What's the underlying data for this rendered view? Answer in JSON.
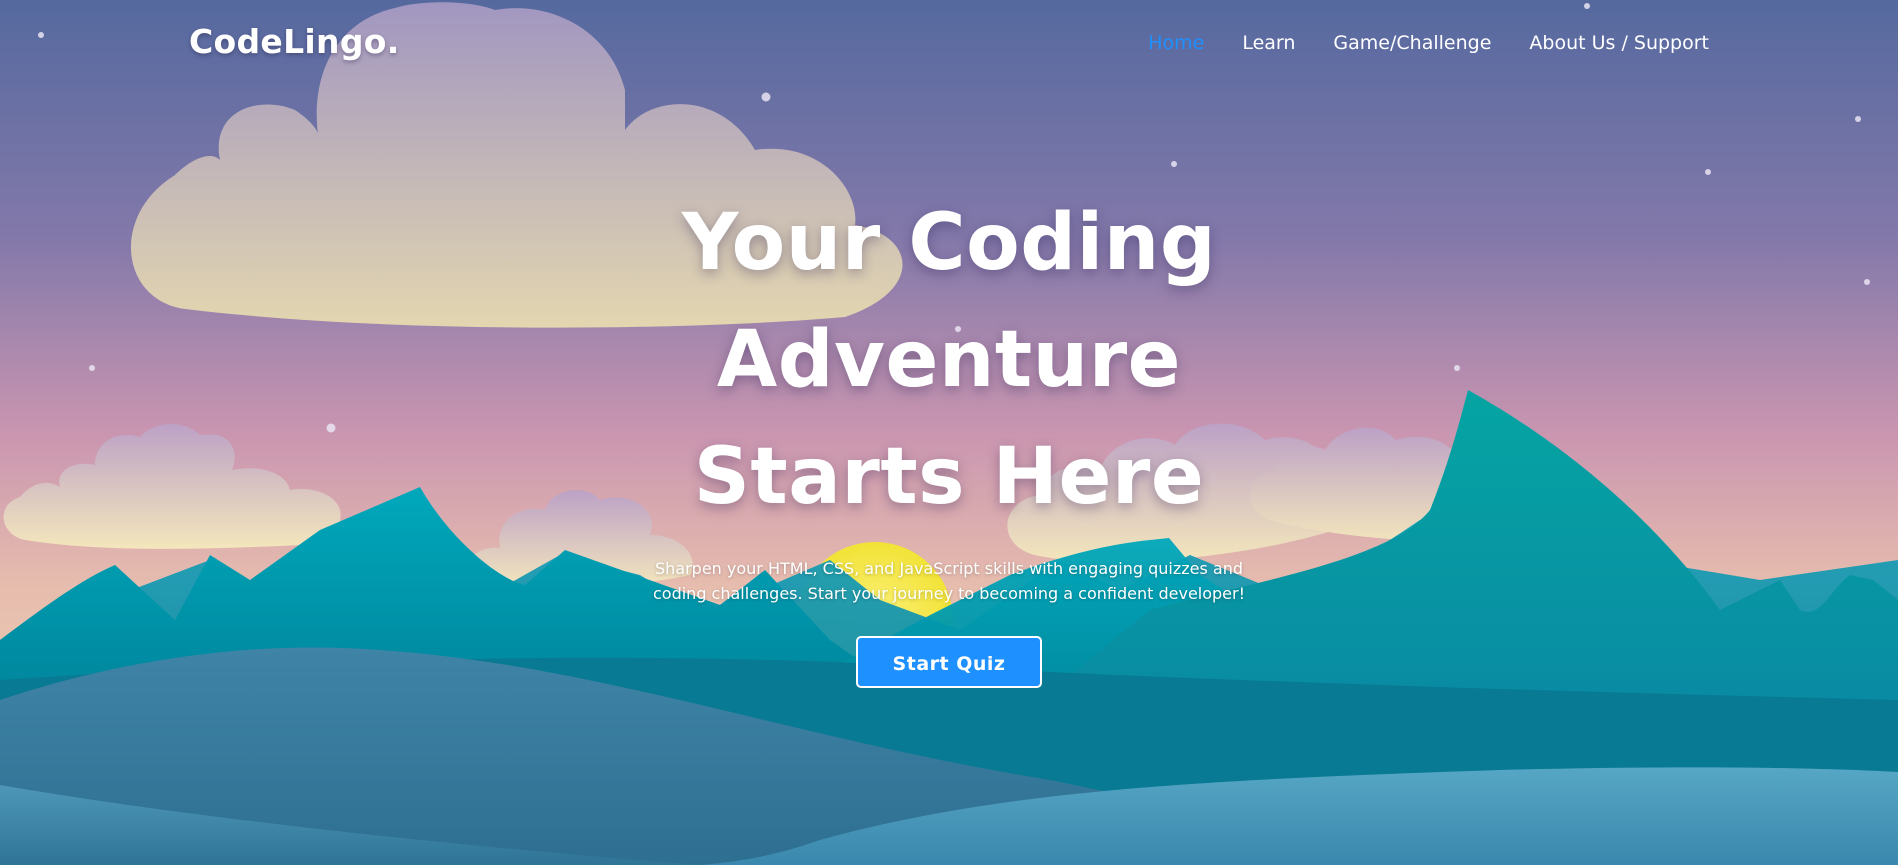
{
  "navbar": {
    "logo": "CodeLingo.",
    "links": [
      {
        "label": "Home",
        "active": true
      },
      {
        "label": "Learn",
        "active": false
      },
      {
        "label": "Game/Challenge",
        "active": false
      },
      {
        "label": "About Us / Support",
        "active": false
      }
    ]
  },
  "hero": {
    "title_lines": [
      "Your Coding",
      "Adventure",
      "Starts Here"
    ],
    "subtitle": "Sharpen your HTML, CSS, and JavaScript skills with engaging quizzes and coding challenges. Start your journey to becoming a confident developer!",
    "cta_label": "Start Quiz"
  },
  "theme": {
    "accent": "#1e90ff",
    "sky_top": "#57699f",
    "sky_mid": "#a07fae",
    "sky_horizon": "#e8c6a7",
    "sun": "#f7ea3a",
    "mountain": "#0a93a8",
    "dune": "#3f8db0"
  }
}
